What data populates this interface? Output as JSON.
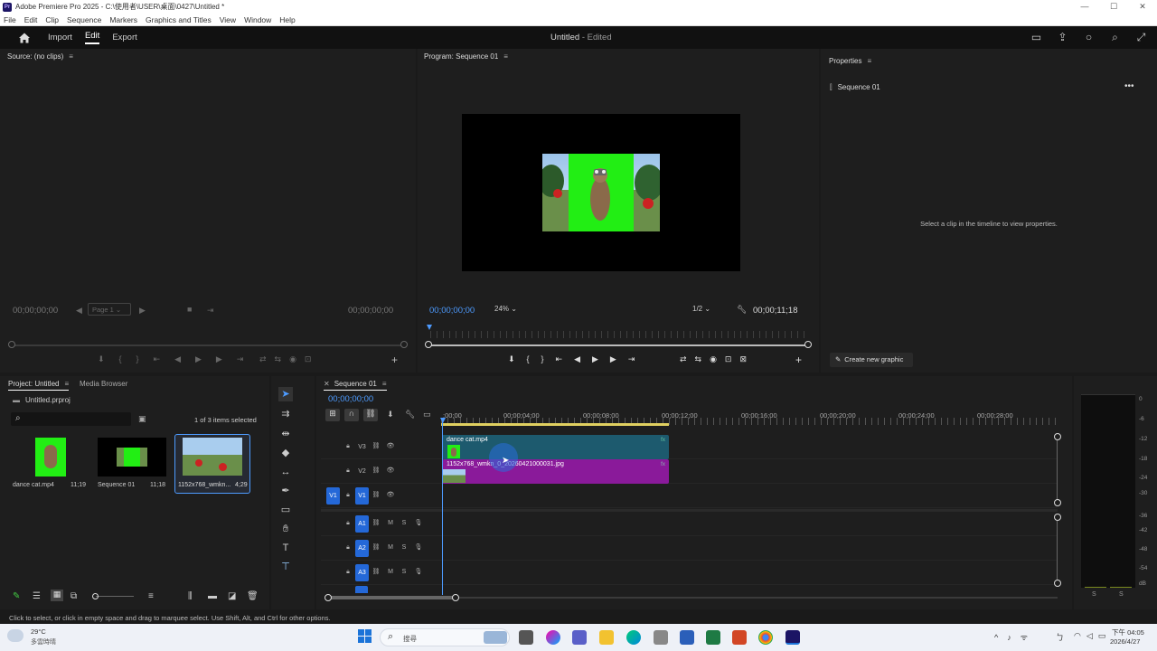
{
  "os": {
    "window_title": "Adobe Premiere Pro 2025 - C:\\使用者\\USER\\桌面\\0427\\Untitled *",
    "menu": [
      "File",
      "Edit",
      "Clip",
      "Sequence",
      "Markers",
      "Graphics and Titles",
      "View",
      "Window",
      "Help"
    ]
  },
  "header": {
    "nav": [
      "Import",
      "Edit",
      "Export"
    ],
    "doc_title": "Untitled",
    "doc_status": " - Edited"
  },
  "source": {
    "title": "Source: (no clips)",
    "tc_left": "00;00;00;00",
    "page": "Page 1",
    "tc_right": "00;00;00;00"
  },
  "program": {
    "title": "Program: Sequence 01",
    "tc_current": "00;00;00;00",
    "zoom": "24%",
    "resolution": "1/2",
    "tc_duration": "00;00;11;18"
  },
  "properties": {
    "title": "Properties",
    "item": "Sequence 01",
    "hint": "Select a clip in the timeline to view properties.",
    "create_button": "Create new graphic"
  },
  "project": {
    "tab_active": "Project: Untitled",
    "tab_other": "Media Browser",
    "file": "Untitled.prproj",
    "selection_info": "1 of 3 items selected",
    "items": [
      {
        "name": "dance cat.mp4",
        "duration": "11;19"
      },
      {
        "name": "Sequence 01",
        "duration": "11;18"
      },
      {
        "name": "1152x768_wmkn...",
        "duration": "4;29"
      }
    ]
  },
  "timeline": {
    "tab": "Sequence 01",
    "timecode": "00;00;00;00",
    "ruler": [
      ":00;00",
      "00;00;04;00",
      "00;00;08;00",
      "00;00;12;00",
      "00;00;16;00",
      "00;00;20;00",
      "00;00;24;00",
      "00;00;28;00"
    ],
    "tracks": [
      {
        "name": "V3",
        "type": "video"
      },
      {
        "name": "V2",
        "type": "video"
      },
      {
        "name": "V1",
        "type": "video",
        "source": "V1"
      },
      {
        "name": "A1",
        "type": "audio",
        "m": "M",
        "s": "S"
      },
      {
        "name": "A2",
        "type": "audio",
        "m": "M",
        "s": "S"
      },
      {
        "name": "A3",
        "type": "audio",
        "m": "M",
        "s": "S"
      }
    ],
    "clips": {
      "v3": {
        "label": "dance cat.mp4",
        "fx": "fx"
      },
      "v2": {
        "label": "1152x768_wmkn_0_20260421000031.jpg",
        "fx": "fx"
      }
    }
  },
  "meter": {
    "labels": [
      "0",
      "-6",
      "-12",
      "-18",
      "-24",
      "-30",
      "-36",
      "-42",
      "-48",
      "-54",
      "dB"
    ],
    "solo": [
      "S",
      "S"
    ]
  },
  "status_bar": "Click to select, or click in empty space and drag to marquee select. Use Shift, Alt, and Ctrl for other options.",
  "taskbar": {
    "weather_temp": "29°C",
    "weather_desc": "多雲時晴",
    "search": "搜尋",
    "time": "下午 04:05",
    "date": "2026/4/27"
  },
  "colors": {
    "accent_blue": "#2468d8",
    "clip_teal": "#1d5a6e",
    "clip_magenta": "#8a1a9a",
    "timecode_blue": "#4d9bff"
  }
}
